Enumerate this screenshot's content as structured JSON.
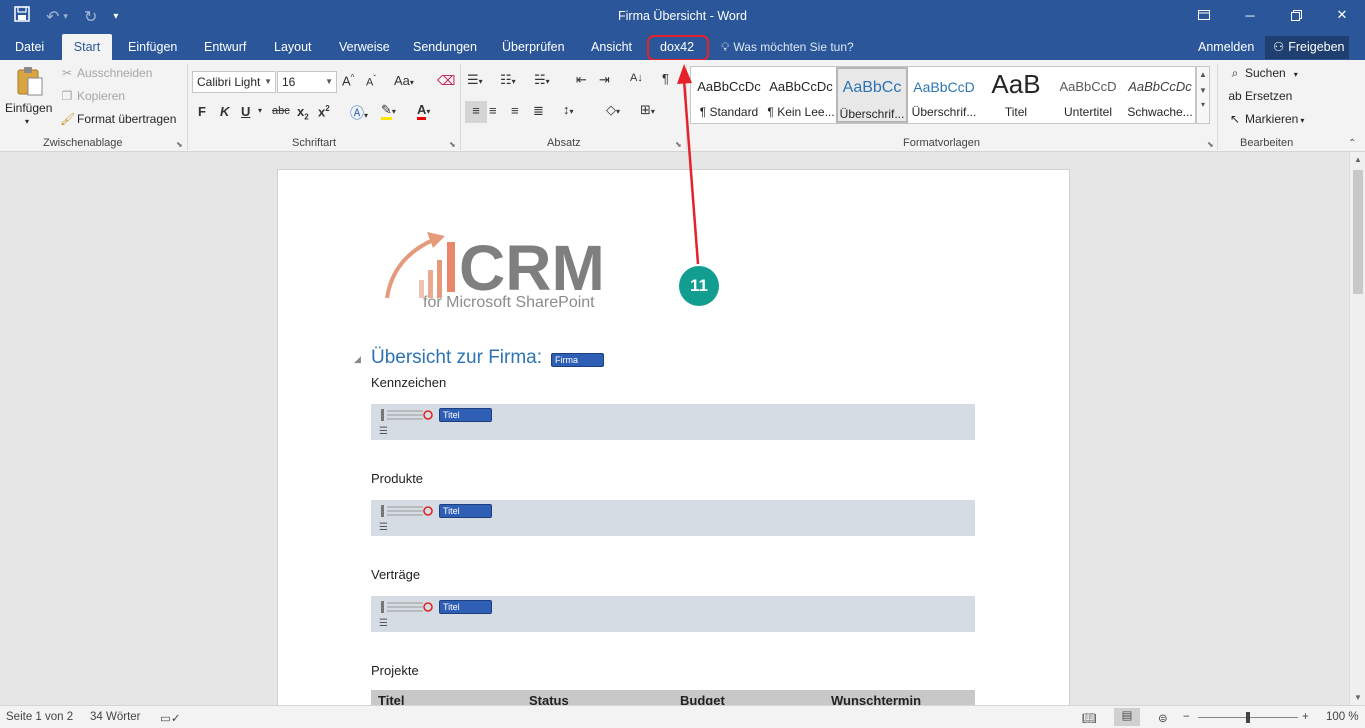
{
  "window": {
    "title": "Firma Übersicht - Word"
  },
  "tabs": [
    "Datei",
    "Start",
    "Einfügen",
    "Entwurf",
    "Layout",
    "Verweise",
    "Sendungen",
    "Überprüfen",
    "Ansicht",
    "dox42"
  ],
  "tell_me": "Was möchten Sie tun?",
  "account": {
    "signin": "Anmelden",
    "share": "Freigeben"
  },
  "clipboard": {
    "paste": "Einfügen",
    "cut": "Ausschneiden",
    "copy": "Kopieren",
    "format_painter": "Format übertragen",
    "label": "Zwischenablage"
  },
  "font": {
    "name": "Calibri Light",
    "size": "16",
    "label": "Schriftart"
  },
  "paragraph": {
    "label": "Absatz"
  },
  "styles": {
    "items": [
      {
        "preview": "AaBbCcDc",
        "name": "¶ Standard"
      },
      {
        "preview": "AaBbCcDc",
        "name": "¶ Kein Lee..."
      },
      {
        "preview": "AaBbCc",
        "name": "Überschrif..."
      },
      {
        "preview": "AaBbCcD",
        "name": "Überschrif..."
      },
      {
        "preview": "AaB",
        "name": "Titel"
      },
      {
        "preview": "AaBbCcD",
        "name": "Untertitel"
      },
      {
        "preview": "AaBbCcDc",
        "name": "Schwache..."
      }
    ],
    "label": "Formatvorlagen"
  },
  "editing": {
    "find": "Suchen",
    "replace": "Ersetzen",
    "select": "Markieren",
    "label": "Bearbeiten"
  },
  "document": {
    "logo_text": "CRM",
    "logo_sub": "for Microsoft SharePoint",
    "heading": "Übersicht zur Firma:",
    "heading_field": "Firma",
    "sections": [
      {
        "label": "Kennzeichen",
        "field": "Titel"
      },
      {
        "label": "Produkte",
        "field": "Titel"
      },
      {
        "label": "Verträge",
        "field": "Titel"
      }
    ],
    "projects_label": "Projekte",
    "table_headers": [
      "Titel",
      "Status",
      "Budget",
      "Wunschtermin"
    ]
  },
  "callout": {
    "number": "11"
  },
  "status": {
    "page": "Seite 1 von 2",
    "words": "34 Wörter",
    "zoom": "100 %"
  },
  "colors": {
    "title_bar": "#2b579a",
    "callout": "#119e91",
    "highlight": "#e5212b"
  }
}
